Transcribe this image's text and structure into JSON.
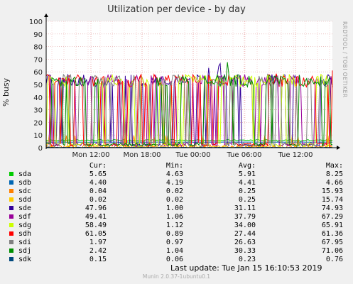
{
  "title": "Utilization per device - by day",
  "ylabel": "% busy",
  "side_label": "RRDTOOL / TOBI OETIKER",
  "legend_headers": {
    "cur": "Cur:",
    "min": "Min:",
    "avg": "Avg:",
    "max": "Max:"
  },
  "devices": [
    {
      "name": "sda",
      "color": "#00cc00",
      "cur": "5.65",
      "min": "4.63",
      "avg": "5.91",
      "max": "8.25"
    },
    {
      "name": "sdb",
      "color": "#0066b3",
      "cur": "4.40",
      "min": "4.19",
      "avg": "4.41",
      "max": "4.66"
    },
    {
      "name": "sdc",
      "color": "#ff8000",
      "cur": "0.04",
      "min": "0.02",
      "avg": "0.25",
      "max": "15.93"
    },
    {
      "name": "sdd",
      "color": "#ffcc00",
      "cur": "0.02",
      "min": "0.02",
      "avg": "0.25",
      "max": "15.74"
    },
    {
      "name": "sde",
      "color": "#330099",
      "cur": "47.96",
      "min": "1.00",
      "avg": "31.11",
      "max": "74.93"
    },
    {
      "name": "sdf",
      "color": "#990099",
      "cur": "49.41",
      "min": "1.06",
      "avg": "37.79",
      "max": "67.29"
    },
    {
      "name": "sdg",
      "color": "#ccff00",
      "cur": "58.49",
      "min": "1.12",
      "avg": "34.00",
      "max": "65.91"
    },
    {
      "name": "sdh",
      "color": "#ff0000",
      "cur": "61.05",
      "min": "0.89",
      "avg": "27.44",
      "max": "61.36"
    },
    {
      "name": "sdi",
      "color": "#808080",
      "cur": "1.97",
      "min": "0.97",
      "avg": "26.63",
      "max": "67.95"
    },
    {
      "name": "sdj",
      "color": "#008f00",
      "cur": "2.42",
      "min": "1.04",
      "avg": "30.33",
      "max": "71.06"
    },
    {
      "name": "sdk",
      "color": "#00487d",
      "cur": "0.15",
      "min": "0.06",
      "avg": "0.23",
      "max": "0.76"
    }
  ],
  "last_update": "Last update: Tue Jan 15 16:10:53 2019",
  "footer": "Munin 2.0.37-1ubuntu0.1",
  "chart_data": {
    "type": "line",
    "title": "Utilization per device - by day",
    "ylabel": "% busy",
    "ylim": [
      0,
      100
    ],
    "yticks": [
      0,
      10,
      20,
      30,
      40,
      50,
      60,
      70,
      80,
      90,
      100
    ],
    "xticks": [
      "Mon 12:00",
      "Mon 18:00",
      "Tue 00:00",
      "Tue 06:00",
      "Tue 12:00"
    ],
    "grid": true,
    "legend_placement": "bottom",
    "series": [
      {
        "name": "sda",
        "cur": 5.65,
        "min": 4.63,
        "avg": 5.91,
        "max": 8.25
      },
      {
        "name": "sdb",
        "cur": 4.4,
        "min": 4.19,
        "avg": 4.41,
        "max": 4.66
      },
      {
        "name": "sdc",
        "cur": 0.04,
        "min": 0.02,
        "avg": 0.25,
        "max": 15.93
      },
      {
        "name": "sdd",
        "cur": 0.02,
        "min": 0.02,
        "avg": 0.25,
        "max": 15.74
      },
      {
        "name": "sde",
        "cur": 47.96,
        "min": 1.0,
        "avg": 31.11,
        "max": 74.93
      },
      {
        "name": "sdf",
        "cur": 49.41,
        "min": 1.06,
        "avg": 37.79,
        "max": 67.29
      },
      {
        "name": "sdg",
        "cur": 58.49,
        "min": 1.12,
        "avg": 34.0,
        "max": 65.91
      },
      {
        "name": "sdh",
        "cur": 61.05,
        "min": 0.89,
        "avg": 27.44,
        "max": 61.36
      },
      {
        "name": "sdi",
        "cur": 1.97,
        "min": 0.97,
        "avg": 26.63,
        "max": 67.95
      },
      {
        "name": "sdj",
        "cur": 2.42,
        "min": 1.04,
        "avg": 30.33,
        "max": 71.06
      },
      {
        "name": "sdk",
        "cur": 0.15,
        "min": 0.06,
        "avg": 0.23,
        "max": 0.76
      }
    ]
  }
}
